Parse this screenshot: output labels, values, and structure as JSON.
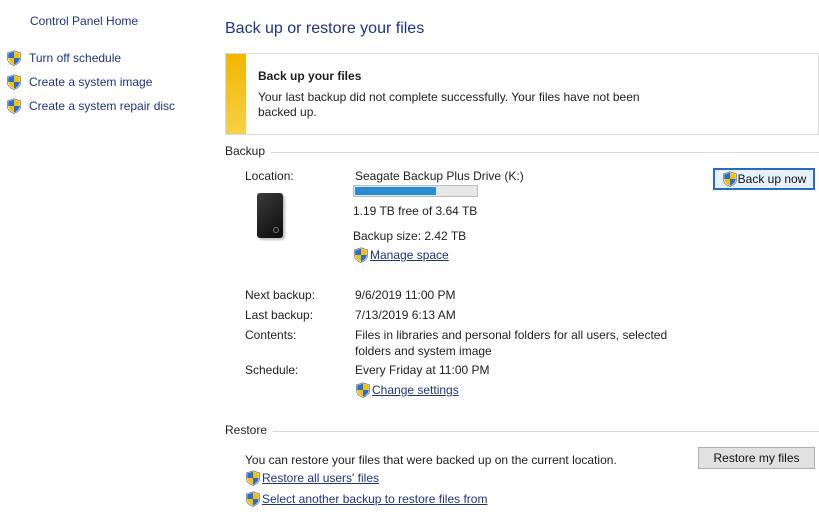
{
  "sidebar": {
    "home": "Control Panel Home",
    "tasks": [
      {
        "label": "Turn off schedule"
      },
      {
        "label": "Create a system image"
      },
      {
        "label": "Create a system repair disc"
      }
    ]
  },
  "page_title": "Back up or restore your files",
  "alert": {
    "heading": "Back up your files",
    "message": "Your last backup did not complete successfully. Your files have not been backed up."
  },
  "backup": {
    "section_title": "Backup",
    "location_label": "Location:",
    "location_value": "Seagate Backup Plus Drive (K:)",
    "usage_fraction": 0.67,
    "free_text": "1.19 TB free of 3.64 TB",
    "backup_size": "Backup size: 2.42 TB",
    "manage_space": "Manage space",
    "next_label": "Next backup:",
    "next_value": "9/6/2019 11:00 PM",
    "last_label": "Last backup:",
    "last_value": "7/13/2019 6:13 AM",
    "contents_label": "Contents:",
    "contents_value": "Files in libraries and personal folders for all users, selected folders and system image",
    "schedule_label": "Schedule:",
    "schedule_value": "Every Friday at 11:00 PM",
    "change_settings": "Change settings",
    "back_up_now": "Back up now"
  },
  "restore": {
    "section_title": "Restore",
    "description": "You can restore your files that were backed up on the current location.",
    "restore_all_users": "Restore all users' files",
    "select_another": "Select another backup to restore files from",
    "restore_my_files": "Restore my files"
  },
  "colors": {
    "link": "#1e3287",
    "warning_bar": "#f2b600",
    "progress_fill": "#2a8ad4"
  },
  "icons": {
    "uac": "shield-icon",
    "drive": "external-drive-icon"
  }
}
